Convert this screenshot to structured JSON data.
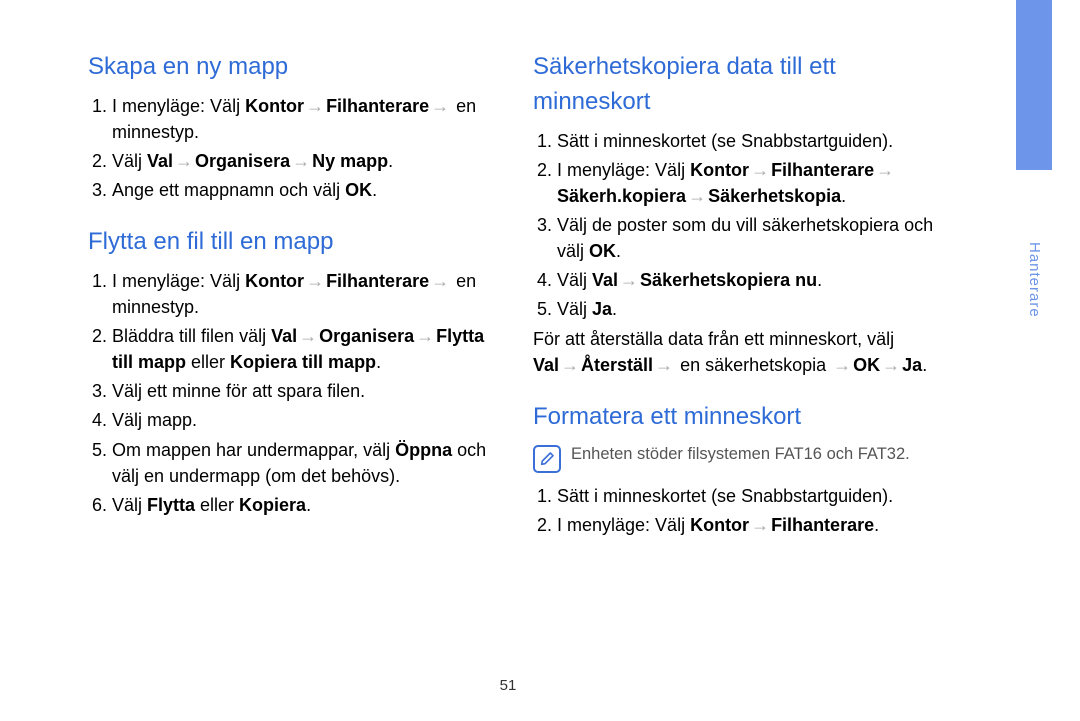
{
  "tab": {
    "label": "Hanterare"
  },
  "page_number": "51",
  "left": {
    "sec1": {
      "heading": "Skapa en ny mapp",
      "items": [
        {
          "pre": "I menyläge: Välj ",
          "b1": "Kontor",
          "mid1": "",
          "b2": "Filhanterare",
          "tail": " en minnestyp."
        },
        {
          "pre": "Välj ",
          "b1": "Val",
          "mid1": "",
          "b2": "Organisera",
          "mid2": "",
          "b3": "Ny mapp",
          "tail": "."
        },
        {
          "pre": "Ange ett mappnamn och välj ",
          "b1": "OK",
          "tail": "."
        }
      ]
    },
    "sec2": {
      "heading": "Flytta en fil till en mapp",
      "items": [
        {
          "pre": "I menyläge: Välj ",
          "b1": "Kontor",
          "b2": "Filhanterare",
          "tail": " en minnestyp."
        },
        {
          "pre": "Bläddra till filen välj ",
          "b1": "Val",
          "b2": "Organisera",
          "line2pre": "",
          "b3": "Flytta till mapp",
          "mid": " eller ",
          "b4": "Kopiera till mapp",
          "tail": "."
        },
        {
          "pre": "Välj ett minne för att spara filen.",
          "tail": ""
        },
        {
          "pre": "Välj mapp.",
          "tail": ""
        },
        {
          "pre": "Om mappen har undermappar, välj ",
          "b1": "Öppna",
          "tail": " och välj en undermapp (om det behövs)."
        },
        {
          "pre": "Välj ",
          "b1": "Flytta",
          "mid": " eller ",
          "b2": "Kopiera",
          "tail": "."
        }
      ]
    }
  },
  "right": {
    "sec1": {
      "heading": "Säkerhetskopiera data till ett minneskort",
      "items": [
        {
          "pre": "Sätt i minneskortet (se Snabbstartguiden).",
          "tail": ""
        },
        {
          "pre": "I menyläge: Välj ",
          "b1": "Kontor",
          "b2": "Filhanterare",
          "line2b1": "Säkerh.kopiera",
          "line2b2": "Säkerhetskopia",
          "tail": "."
        },
        {
          "pre": "Välj de poster som du vill säkerhetskopiera och välj ",
          "b1": "OK",
          "tail": "."
        },
        {
          "pre": "Välj ",
          "b1": "Val",
          "b2": "Säkerhetskopiera nu",
          "tail": "."
        },
        {
          "pre": "Välj ",
          "b1": "Ja",
          "tail": "."
        }
      ],
      "after_pre": "För att återställa data från ett minneskort, välj",
      "after_b1": "Val",
      "after_b2": "Återställ",
      "after_mid": " en säkerhetskopia ",
      "after_b3": "OK",
      "after_b4": "Ja",
      "after_tail": "."
    },
    "sec2": {
      "heading": "Formatera ett minneskort",
      "note": "Enheten stöder filsystemen FAT16 och FAT32.",
      "items": [
        {
          "pre": "Sätt i minneskortet (se Snabbstartguiden).",
          "tail": ""
        },
        {
          "pre": "I menyläge: Välj ",
          "b1": "Kontor",
          "b2": "Filhanterare",
          "tail": "."
        }
      ]
    }
  }
}
